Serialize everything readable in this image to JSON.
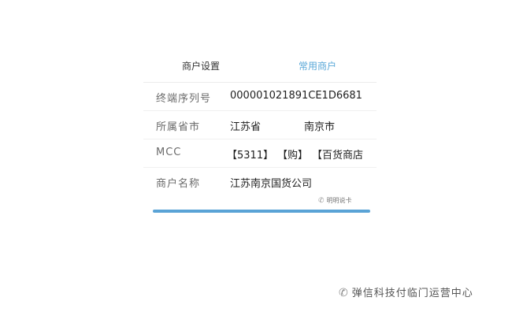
{
  "tabs": {
    "merchant_settings": "商户设置",
    "common_merchants": "常用商户"
  },
  "fields": {
    "terminal_serial": {
      "label": "终端序列号",
      "value": "000001021891CE1D6681"
    },
    "province_city": {
      "label": "所属省市",
      "province": "江苏省",
      "city": "南京市"
    },
    "mcc": {
      "label": "MCC",
      "code": "【5311】",
      "category": "【购】",
      "type": "【百货商店"
    },
    "merchant_name": {
      "label": "商户名称",
      "value": "江苏南京国货公司"
    }
  },
  "watermarks": {
    "small": "明明说卡",
    "large": "弹信科技付临门运营中心"
  },
  "colors": {
    "accent": "#5aa3d6",
    "tab_active_text": "#5aa8d8"
  },
  "icons": {
    "wechat": "wechat-icon"
  }
}
